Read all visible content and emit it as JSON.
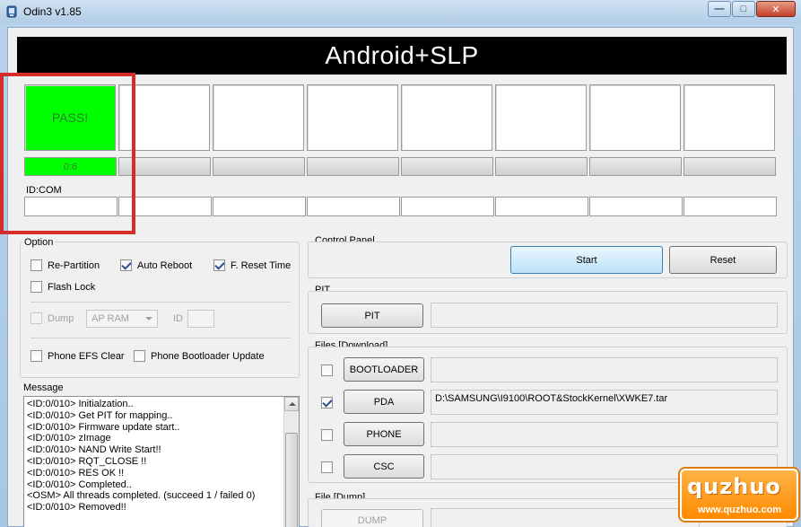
{
  "window": {
    "title": "Odin3 v1.85",
    "minimize_glyph": "—",
    "maximize_glyph": "□",
    "close_glyph": "✕"
  },
  "banner": "Android+SLP",
  "slots": [
    {
      "label": "PASS!",
      "status": "pass"
    },
    {
      "label": ""
    },
    {
      "label": ""
    },
    {
      "label": ""
    },
    {
      "label": ""
    },
    {
      "label": ""
    },
    {
      "label": ""
    },
    {
      "label": ""
    }
  ],
  "progress": [
    {
      "label": "0:6",
      "fraction": 1.0
    },
    {
      "label": "",
      "fraction": 0
    },
    {
      "label": "",
      "fraction": 0
    },
    {
      "label": "",
      "fraction": 0
    },
    {
      "label": "",
      "fraction": 0
    },
    {
      "label": "",
      "fraction": 0
    },
    {
      "label": "",
      "fraction": 0
    },
    {
      "label": "",
      "fraction": 0
    }
  ],
  "idcom": {
    "label": "ID:COM",
    "ports": [
      "",
      "",
      "",
      "",
      "",
      "",
      "",
      ""
    ]
  },
  "option": {
    "title": "Option",
    "re_partition": {
      "label": "Re-Partition",
      "checked": false
    },
    "auto_reboot": {
      "label": "Auto Reboot",
      "checked": true
    },
    "f_reset_time": {
      "label": "F. Reset Time",
      "checked": true
    },
    "flash_lock": {
      "label": "Flash Lock",
      "checked": false
    },
    "dump": {
      "label": "Dump",
      "checked": false,
      "enabled": false
    },
    "dump_target": "AP RAM",
    "id_label": "ID",
    "id_value": "",
    "phone_efs_clear": {
      "label": "Phone EFS Clear",
      "checked": false
    },
    "phone_bootloader_update": {
      "label": "Phone Bootloader Update",
      "checked": false
    }
  },
  "message": {
    "title": "Message",
    "lines": [
      "<ID:0/010> Initialzation..",
      "<ID:0/010> Get PIT for mapping..",
      "<ID:0/010> Firmware update start..",
      "<ID:0/010> zImage",
      "<ID:0/010> NAND Write Start!!",
      "<ID:0/010> RQT_CLOSE !!",
      "<ID:0/010> RES OK !!",
      "<ID:0/010> Completed..",
      "<OSM> All threads completed. (succeed 1 / failed 0)",
      "<ID:0/010> Removed!!"
    ]
  },
  "control_panel": {
    "title": "Control Panel",
    "start_label": "Start",
    "reset_label": "Reset"
  },
  "pit": {
    "title": "PIT",
    "button_label": "PIT",
    "path": ""
  },
  "files_download": {
    "title": "Files [Download]",
    "bootloader": {
      "label": "BOOTLOADER",
      "checked": false,
      "path": ""
    },
    "pda": {
      "label": "PDA",
      "checked": true,
      "path": "D:\\SAMSUNG\\I9100\\ROOT&StockKernel\\XWKE7.tar"
    },
    "phone": {
      "label": "PHONE",
      "checked": false,
      "path": ""
    },
    "csc": {
      "label": "CSC",
      "checked": false,
      "path": ""
    }
  },
  "file_dump": {
    "title": "File [Dump]",
    "button_label": "DUMP",
    "path": ""
  },
  "watermark": {
    "brand": "quzhuo",
    "url": "www.quzhuo.com"
  }
}
